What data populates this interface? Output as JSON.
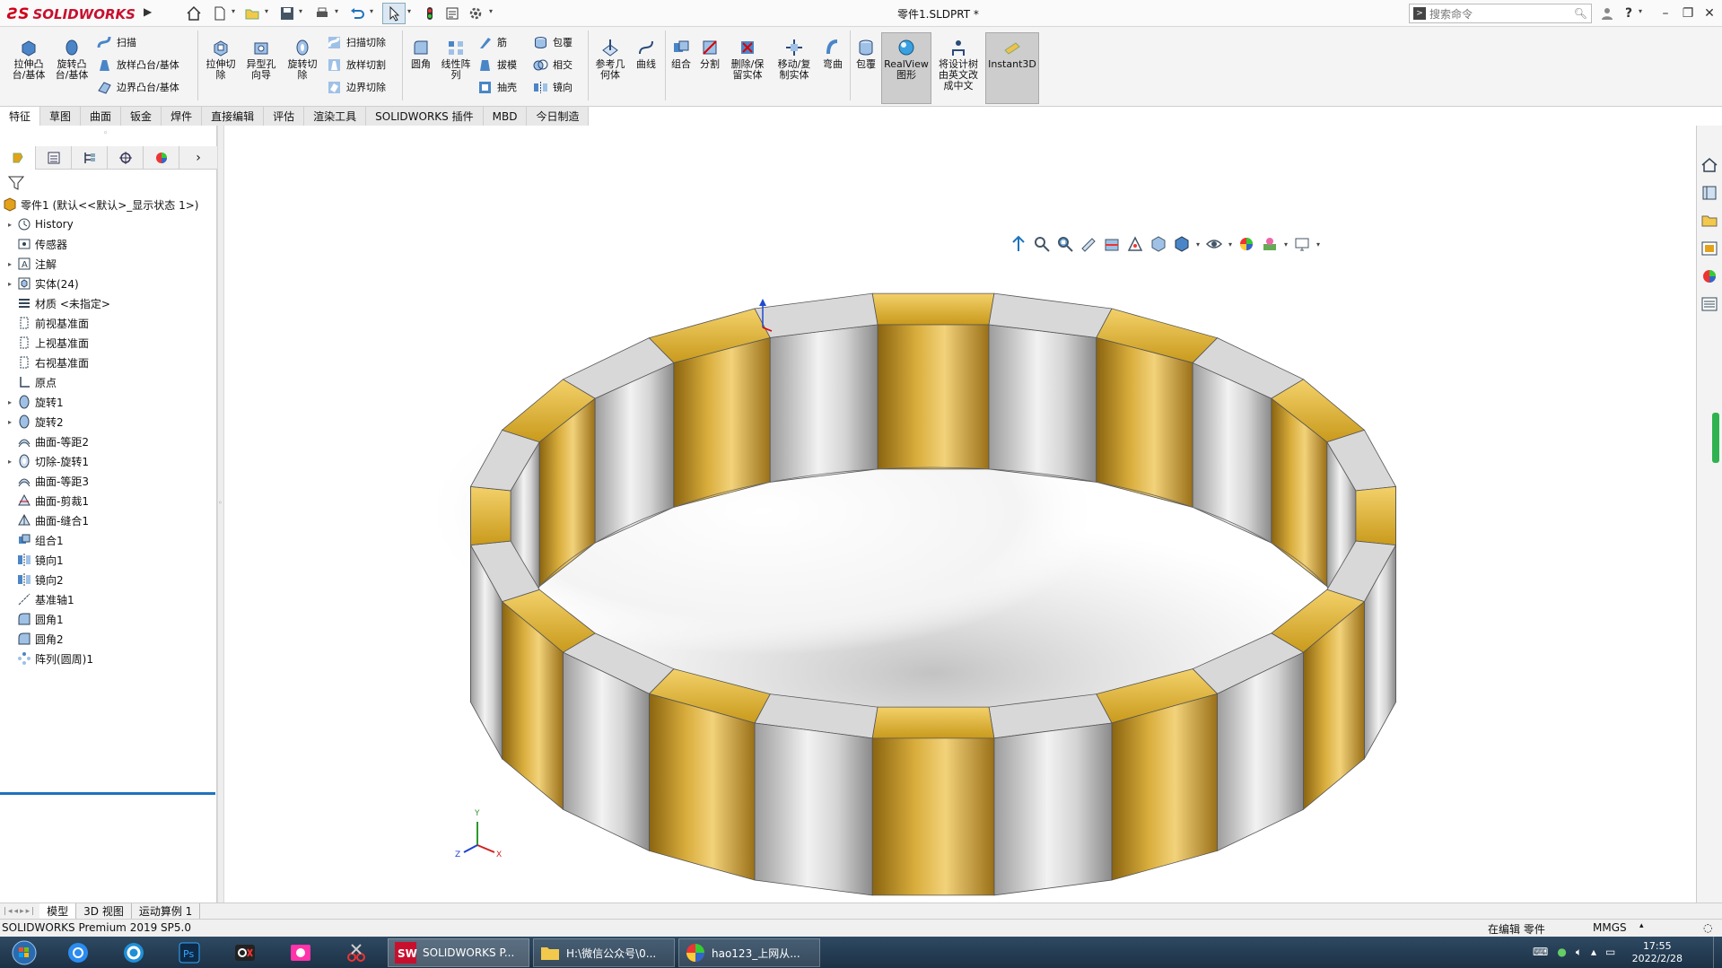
{
  "app": {
    "logo_text": "SOLIDWORKS",
    "doc_title": "零件1.SLDPRT *"
  },
  "search": {
    "placeholder": "搜索命令"
  },
  "window_controls": {
    "help": "?",
    "minimize": "–",
    "restore": "❐",
    "close": "✕"
  },
  "ribbon": {
    "big_tools": [
      {
        "label": "拉伸凸\n台/基体",
        "icon": "extrude-boss-icon"
      },
      {
        "label": "旋转凸\n台/基体",
        "icon": "revolve-boss-icon"
      },
      {
        "label": "拉伸切\n除",
        "icon": "extrude-cut-icon"
      },
      {
        "label": "异型孔\n向导",
        "icon": "hole-wizard-icon"
      },
      {
        "label": "旋转切\n除",
        "icon": "revolve-cut-icon"
      },
      {
        "label": "圆角",
        "icon": "fillet-icon"
      },
      {
        "label": "线性阵\n列",
        "icon": "linear-pattern-icon"
      },
      {
        "label": "参考几\n何体",
        "icon": "reference-geometry-icon"
      },
      {
        "label": "曲线",
        "icon": "curves-icon"
      },
      {
        "label": "组合",
        "icon": "combine-icon"
      },
      {
        "label": "分割",
        "icon": "split-icon"
      },
      {
        "label": "删除/保\n留实体",
        "icon": "delete-body-icon"
      },
      {
        "label": "移动/复\n制实体",
        "icon": "move-copy-body-icon"
      },
      {
        "label": "弯曲",
        "icon": "flex-icon"
      },
      {
        "label": "包覆",
        "icon": "wrap-icon"
      },
      {
        "label": "RealView\n图形",
        "icon": "realview-icon"
      },
      {
        "label": "将设计树\n由英文改\n成中文",
        "icon": "translate-tree-icon"
      },
      {
        "label": "Instant3D",
        "icon": "instant3d-icon"
      }
    ],
    "small_tools": [
      {
        "label": "扫描",
        "icon": "sweep-icon"
      },
      {
        "label": "放样凸台/基体",
        "icon": "loft-boss-icon"
      },
      {
        "label": "边界凸台/基体",
        "icon": "boundary-boss-icon"
      },
      {
        "label": "扫描切除",
        "icon": "swept-cut-icon"
      },
      {
        "label": "放样切割",
        "icon": "lofted-cut-icon"
      },
      {
        "label": "边界切除",
        "icon": "boundary-cut-icon"
      },
      {
        "label": "筋",
        "icon": "rib-icon"
      },
      {
        "label": "拔模",
        "icon": "draft-icon"
      },
      {
        "label": "抽壳",
        "icon": "shell-icon"
      },
      {
        "label": "包覆",
        "icon": "wrap-small-icon"
      },
      {
        "label": "相交",
        "icon": "intersect-icon"
      },
      {
        "label": "镜向",
        "icon": "mirror-icon"
      }
    ]
  },
  "tabs": [
    "特征",
    "草图",
    "曲面",
    "钣金",
    "焊件",
    "直接编辑",
    "评估",
    "渲染工具",
    "SOLIDWORKS 插件",
    "MBD",
    "今日制造"
  ],
  "tree": {
    "root": "零件1 (默认<<默认>_显示状态 1>)",
    "items": [
      {
        "label": "History",
        "icon": "history-icon",
        "expand": "▸"
      },
      {
        "label": "传感器",
        "icon": "sensor-icon",
        "expand": ""
      },
      {
        "label": "注解",
        "icon": "annotation-icon",
        "expand": "▸"
      },
      {
        "label": "实体(24)",
        "icon": "solid-bodies-icon",
        "expand": "▸"
      },
      {
        "label": "材质 <未指定>",
        "icon": "material-icon",
        "expand": ""
      },
      {
        "label": "前视基准面",
        "icon": "plane-icon",
        "expand": ""
      },
      {
        "label": "上视基准面",
        "icon": "plane-icon",
        "expand": ""
      },
      {
        "label": "右视基准面",
        "icon": "plane-icon",
        "expand": ""
      },
      {
        "label": "原点",
        "icon": "origin-icon",
        "expand": ""
      },
      {
        "label": "旋转1",
        "icon": "revolve-feature-icon",
        "expand": "▸"
      },
      {
        "label": "旋转2",
        "icon": "revolve-feature-icon",
        "expand": "▸"
      },
      {
        "label": "曲面-等距2",
        "icon": "offset-surface-icon",
        "expand": ""
      },
      {
        "label": "切除-旋转1",
        "icon": "cut-revolve-icon",
        "expand": "▸"
      },
      {
        "label": "曲面-等距3",
        "icon": "offset-surface-icon",
        "expand": ""
      },
      {
        "label": "曲面-剪裁1",
        "icon": "trim-surface-icon",
        "expand": ""
      },
      {
        "label": "曲面-缝合1",
        "icon": "knit-surface-icon",
        "expand": ""
      },
      {
        "label": "组合1",
        "icon": "combine-feature-icon",
        "expand": ""
      },
      {
        "label": "镜向1",
        "icon": "mirror-feature-icon",
        "expand": ""
      },
      {
        "label": "镜向2",
        "icon": "mirror-feature-icon",
        "expand": ""
      },
      {
        "label": "基准轴1",
        "icon": "axis-icon",
        "expand": ""
      },
      {
        "label": "圆角1",
        "icon": "fillet-feature-icon",
        "expand": ""
      },
      {
        "label": "圆角2",
        "icon": "fillet-feature-icon",
        "expand": ""
      },
      {
        "label": "阵列(圆周)1",
        "icon": "circular-pattern-icon",
        "expand": ""
      }
    ]
  },
  "bottom_tabs": [
    "模型",
    "3D 视图",
    "运动算例 1"
  ],
  "status": {
    "left": "SOLIDWORKS Premium 2019 SP5.0",
    "editing": "在编辑 零件",
    "units": "MMGS"
  },
  "taskbar": {
    "tasks": [
      {
        "label": "SOLIDWORKS P...",
        "icon": "solidworks-task-icon"
      },
      {
        "label": "H:\\微信公众号\\0...",
        "icon": "folder-task-icon"
      },
      {
        "label": "hao123_上网从...",
        "icon": "browser-task-icon"
      }
    ],
    "time": "17:55",
    "date": "2022/2/28"
  },
  "triad": {
    "x": "X",
    "y": "Y",
    "z": "Z"
  },
  "colors": {
    "gold": "#c99a1c",
    "silver": "#c8c8c8",
    "accent": "#1e73be",
    "brand_red": "#d0021b"
  }
}
